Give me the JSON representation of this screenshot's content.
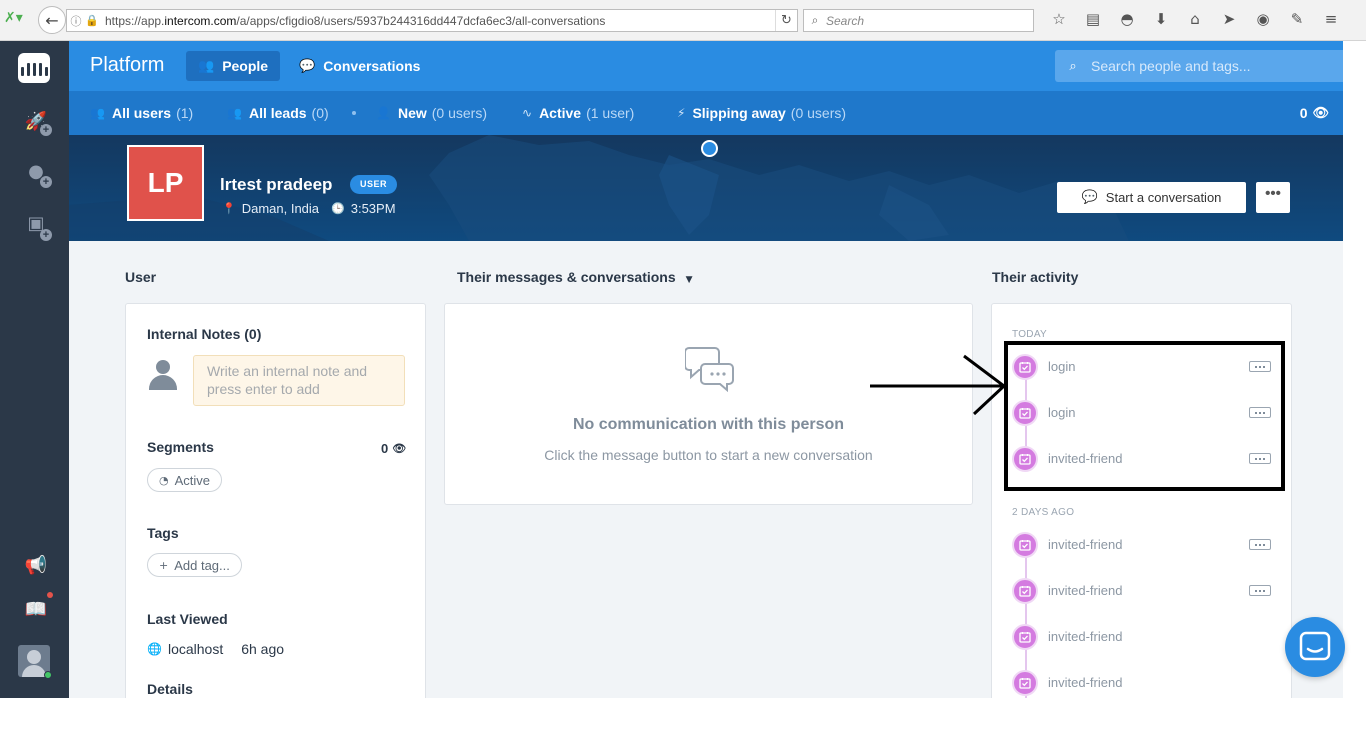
{
  "browser": {
    "url_prefix": "https://app.",
    "url_domain": "intercom.com",
    "url_path": "/a/apps/cfigdio8/users/5937b244316dd447dcfa6ec3/all-conversations",
    "search_placeholder": "Search"
  },
  "header": {
    "brand": "Platform",
    "nav": [
      {
        "label": "People",
        "icon": "people-icon",
        "active": true
      },
      {
        "label": "Conversations",
        "icon": "chat-bubble-icon",
        "active": false
      }
    ],
    "search_placeholder": "Search people and tags..."
  },
  "segments": {
    "items": [
      {
        "label": "All users",
        "count": "(1)",
        "icon": "users-icon"
      },
      {
        "label": "All leads",
        "count": "(0)",
        "icon": "leads-icon"
      },
      {
        "label": "New",
        "count": "(0 users)",
        "icon": "person-icon"
      },
      {
        "label": "Active",
        "count": "(1 user)",
        "icon": "pulse-icon"
      },
      {
        "label": "Slipping away",
        "count": "(0 users)",
        "icon": "bolt-icon"
      }
    ],
    "visibility_count": "0"
  },
  "profile": {
    "initials": "LP",
    "name": "lrtest pradeep",
    "badge": "USER",
    "location": "Daman, India",
    "local_time": "3:53PM",
    "start_conversation_label": "Start a conversation",
    "more_label": "•••",
    "avatar_color": "#e0524b"
  },
  "columns": {
    "user_title": "User",
    "messages_title": "Their messages & conversations",
    "activity_title": "Their activity"
  },
  "user_card": {
    "notes_title": "Internal Notes (0)",
    "note_placeholder": "Write an internal note and press enter to add",
    "segments_title": "Segments",
    "segments_count": "0",
    "segment_pill": "Active",
    "tags_title": "Tags",
    "add_tag_label": "Add tag...",
    "last_viewed_title": "Last Viewed",
    "last_viewed_host": "localhost",
    "last_viewed_ago": "6h ago",
    "details_title": "Details"
  },
  "messages_card": {
    "empty_title": "No communication with this person",
    "empty_subtitle": "Click the message button to start a new conversation"
  },
  "activity": {
    "groups": [
      {
        "label": "TODAY",
        "events": [
          {
            "name": "login",
            "has_more": true
          },
          {
            "name": "login",
            "has_more": true
          },
          {
            "name": "invited-friend",
            "has_more": true
          }
        ]
      },
      {
        "label": "2 DAYS AGO",
        "events": [
          {
            "name": "invited-friend",
            "has_more": true
          },
          {
            "name": "invited-friend",
            "has_more": true
          },
          {
            "name": "invited-friend",
            "has_more": false
          },
          {
            "name": "invited-friend",
            "has_more": false
          }
        ]
      }
    ],
    "event_color": "#d47be0"
  },
  "colors": {
    "primary": "#2a8ce2",
    "segment_bar": "#1f78cb",
    "rail": "#2b3848"
  }
}
